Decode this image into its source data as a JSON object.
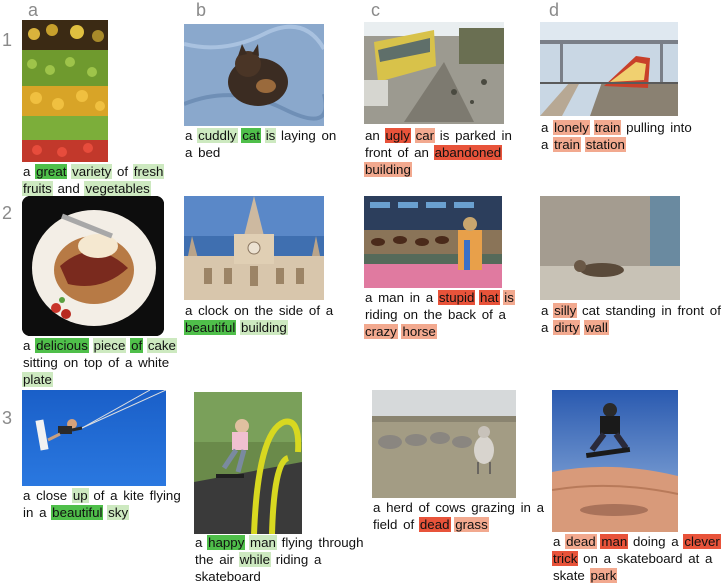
{
  "column_labels": [
    "a",
    "b",
    "c",
    "d"
  ],
  "row_labels": [
    "1",
    "2",
    "3"
  ],
  "colors": {
    "positive_light": "#cde9c0",
    "positive_strong": "#4fbf4a",
    "negative_light": "#f2a98f",
    "negative_strong": "#e8533a"
  },
  "captions": {
    "1a": [
      {
        "t": "a",
        "h": ""
      },
      {
        "t": "great",
        "h": "g2"
      },
      {
        "t": "variety",
        "h": "g1"
      },
      {
        "t": "of",
        "h": ""
      },
      {
        "t": "fresh",
        "h": "g1"
      },
      {
        "t": "fruits",
        "h": "g1"
      },
      {
        "t": "and",
        "h": ""
      },
      {
        "t": "vegetables",
        "h": "g1"
      }
    ],
    "1b": [
      {
        "t": "a",
        "h": ""
      },
      {
        "t": "cuddly",
        "h": "g1"
      },
      {
        "t": "cat",
        "h": "g2"
      },
      {
        "t": "is",
        "h": "g1"
      },
      {
        "t": "laying",
        "h": ""
      },
      {
        "t": "on",
        "h": ""
      },
      {
        "t": "a",
        "h": ""
      },
      {
        "t": "bed",
        "h": ""
      }
    ],
    "1c": [
      {
        "t": "an",
        "h": ""
      },
      {
        "t": "ugly",
        "h": "r2"
      },
      {
        "t": "car",
        "h": "r1"
      },
      {
        "t": "is",
        "h": ""
      },
      {
        "t": "parked",
        "h": ""
      },
      {
        "t": "in",
        "h": ""
      },
      {
        "t": "front",
        "h": ""
      },
      {
        "t": "of",
        "h": ""
      },
      {
        "t": "an",
        "h": ""
      },
      {
        "t": "abandoned",
        "h": "r2"
      },
      {
        "t": "building",
        "h": "r1"
      }
    ],
    "1d": [
      {
        "t": "a",
        "h": ""
      },
      {
        "t": "lonely",
        "h": "r1"
      },
      {
        "t": "train",
        "h": "r1"
      },
      {
        "t": "pulling",
        "h": ""
      },
      {
        "t": "into",
        "h": ""
      },
      {
        "t": "a",
        "h": ""
      },
      {
        "t": "train",
        "h": "r1"
      },
      {
        "t": "station",
        "h": "r1"
      }
    ],
    "2a": [
      {
        "t": "a",
        "h": ""
      },
      {
        "t": "delicious",
        "h": "g2"
      },
      {
        "t": "piece",
        "h": "g1"
      },
      {
        "t": "of",
        "h": "g2"
      },
      {
        "t": "cake",
        "h": "g1"
      },
      {
        "t": "sitting",
        "h": ""
      },
      {
        "t": "on",
        "h": ""
      },
      {
        "t": "top",
        "h": ""
      },
      {
        "t": "of",
        "h": ""
      },
      {
        "t": "a",
        "h": ""
      },
      {
        "t": "white",
        "h": ""
      },
      {
        "t": "plate",
        "h": "g1"
      }
    ],
    "2b": [
      {
        "t": "a",
        "h": ""
      },
      {
        "t": "clock",
        "h": ""
      },
      {
        "t": "on",
        "h": ""
      },
      {
        "t": "the",
        "h": ""
      },
      {
        "t": "side",
        "h": ""
      },
      {
        "t": "of",
        "h": ""
      },
      {
        "t": "a",
        "h": ""
      },
      {
        "t": "beautiful",
        "h": "g2"
      },
      {
        "t": "building",
        "h": "g1"
      }
    ],
    "2c": [
      {
        "t": "a",
        "h": ""
      },
      {
        "t": "man",
        "h": ""
      },
      {
        "t": "in",
        "h": ""
      },
      {
        "t": "a",
        "h": ""
      },
      {
        "t": "stupid",
        "h": "r2"
      },
      {
        "t": "hat",
        "h": "r2"
      },
      {
        "t": "is",
        "h": "r1"
      },
      {
        "t": "riding",
        "h": ""
      },
      {
        "t": "on",
        "h": ""
      },
      {
        "t": "the",
        "h": ""
      },
      {
        "t": "back",
        "h": ""
      },
      {
        "t": "of",
        "h": ""
      },
      {
        "t": "a",
        "h": ""
      },
      {
        "t": "crazy",
        "h": "r1"
      },
      {
        "t": "horse",
        "h": "r1"
      }
    ],
    "2d": [
      {
        "t": "a",
        "h": ""
      },
      {
        "t": "silly",
        "h": "r1"
      },
      {
        "t": "cat",
        "h": ""
      },
      {
        "t": "standing",
        "h": ""
      },
      {
        "t": "in",
        "h": ""
      },
      {
        "t": "front",
        "h": ""
      },
      {
        "t": "of",
        "h": ""
      },
      {
        "t": "a",
        "h": ""
      },
      {
        "t": "dirty",
        "h": "r1"
      },
      {
        "t": "wall",
        "h": "r1"
      }
    ],
    "3a": [
      {
        "t": "a",
        "h": ""
      },
      {
        "t": "close",
        "h": ""
      },
      {
        "t": "up",
        "h": "g1"
      },
      {
        "t": "of",
        "h": ""
      },
      {
        "t": "a",
        "h": ""
      },
      {
        "t": "kite",
        "h": ""
      },
      {
        "t": "flying",
        "h": ""
      },
      {
        "t": "in",
        "h": ""
      },
      {
        "t": "a",
        "h": ""
      },
      {
        "t": "beautiful",
        "h": "g2"
      },
      {
        "t": "sky",
        "h": "g1"
      }
    ],
    "3b": [
      {
        "t": "a",
        "h": ""
      },
      {
        "t": "happy",
        "h": "g2"
      },
      {
        "t": "man",
        "h": "g1"
      },
      {
        "t": "flying",
        "h": ""
      },
      {
        "t": "through",
        "h": ""
      },
      {
        "t": "the",
        "h": ""
      },
      {
        "t": "air",
        "h": ""
      },
      {
        "t": "while",
        "h": "g1"
      },
      {
        "t": "riding",
        "h": ""
      },
      {
        "t": "a",
        "h": ""
      },
      {
        "t": "skateboard",
        "h": ""
      }
    ],
    "3c": [
      {
        "t": "a",
        "h": ""
      },
      {
        "t": "herd",
        "h": ""
      },
      {
        "t": "of",
        "h": ""
      },
      {
        "t": "cows",
        "h": ""
      },
      {
        "t": "grazing",
        "h": ""
      },
      {
        "t": "in",
        "h": ""
      },
      {
        "t": "a",
        "h": ""
      },
      {
        "t": "field",
        "h": ""
      },
      {
        "t": "of",
        "h": ""
      },
      {
        "t": "dead",
        "h": "r2"
      },
      {
        "t": "grass",
        "h": "r1"
      }
    ],
    "3d": [
      {
        "t": "a",
        "h": ""
      },
      {
        "t": "dead",
        "h": "r1"
      },
      {
        "t": "man",
        "h": "r2"
      },
      {
        "t": "doing",
        "h": ""
      },
      {
        "t": "a",
        "h": ""
      },
      {
        "t": "clever",
        "h": "r2"
      },
      {
        "t": "trick",
        "h": "r2"
      },
      {
        "t": "on",
        "h": ""
      },
      {
        "t": "a",
        "h": ""
      },
      {
        "t": "skateboard",
        "h": ""
      },
      {
        "t": "at",
        "h": ""
      },
      {
        "t": "a",
        "h": ""
      },
      {
        "t": "skate",
        "h": ""
      },
      {
        "t": "park",
        "h": "r1"
      }
    ]
  }
}
